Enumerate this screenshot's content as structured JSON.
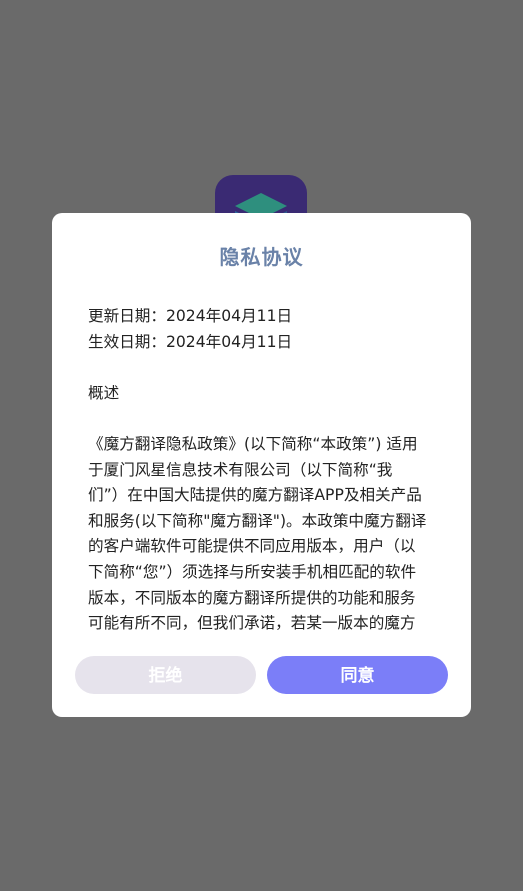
{
  "app_logo_icon": "magic-cube-icon",
  "dialog": {
    "title": "隐私协议",
    "update_date": "更新日期：2024年04月11日",
    "effective_date": "生效日期：2024年04月11日",
    "section_heading": "概述",
    "body_lines": [
      "《魔方翻译隐私政策》(以下简称“本政策”) 适用",
      "于厦门风星信息技术有限公司（以下简称“我",
      "们”）在中国大陆提供的魔方翻译APP及相关产品",
      "和服务(以下简称\"魔方翻译\")。本政策中魔方翻译",
      "的客户端软件可能提供不同应用版本，用户（以",
      "下简称“您”）须选择与所安装手机相匹配的软件",
      "版本，不同版本的魔方翻译所提供的功能和服务",
      "可能有所不同，但我们承诺，若某一版本的魔方"
    ],
    "reject_label": "拒绝",
    "agree_label": "同意"
  },
  "colors": {
    "overlay": "#6a6a6a",
    "title": "#6a82a8",
    "reject_button": "#e6e3ec",
    "agree_button": "#7b7ef8"
  }
}
